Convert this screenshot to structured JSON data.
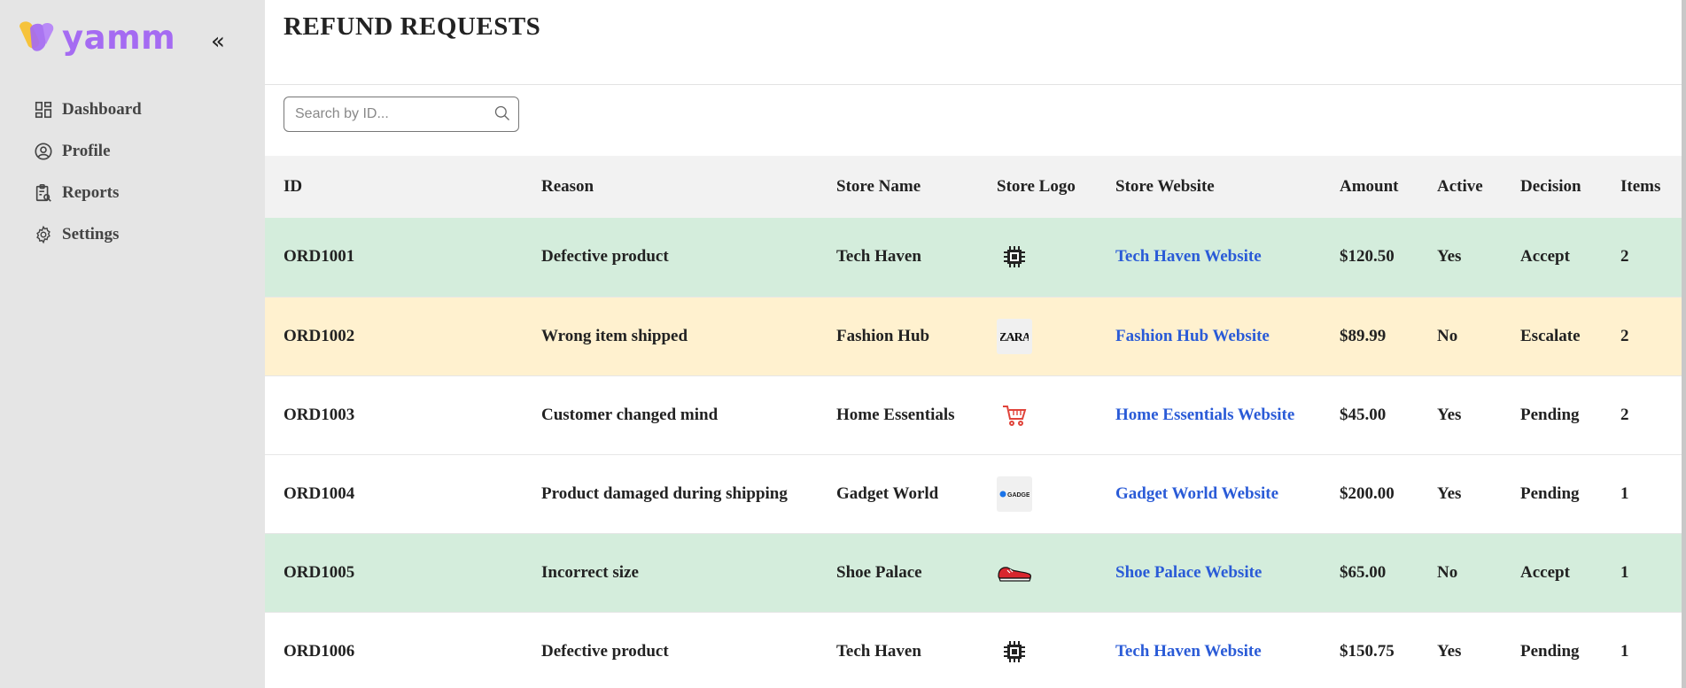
{
  "brand": {
    "name": "yamm",
    "primary": "#a56bf2",
    "secondary": "#f6c33b"
  },
  "sidebar": {
    "collapse_label": "«",
    "items": [
      {
        "label": "Dashboard",
        "icon": "dashboard-icon"
      },
      {
        "label": "Profile",
        "icon": "user-circle-icon"
      },
      {
        "label": "Reports",
        "icon": "clipboard-search-icon"
      },
      {
        "label": "Settings",
        "icon": "gear-icon"
      }
    ]
  },
  "page": {
    "title": "REFUND REQUESTS"
  },
  "search": {
    "placeholder": "Search by ID...",
    "value": ""
  },
  "table": {
    "headers": [
      "ID",
      "Reason",
      "Store Name",
      "Store Logo",
      "Store Website",
      "Amount",
      "Active",
      "Decision",
      "Items"
    ],
    "rows": [
      {
        "id": "ORD1001",
        "reason": "Defective product",
        "store": "Tech Haven",
        "logo": "chip-icon",
        "website": "Tech Haven Website",
        "amount": "$120.50",
        "active": "Yes",
        "decision": "Accept",
        "items": "2",
        "status": "accept"
      },
      {
        "id": "ORD1002",
        "reason": "Wrong item shipped",
        "store": "Fashion Hub",
        "logo": "zara-logo",
        "website": "Fashion Hub Website",
        "amount": "$89.99",
        "active": "No",
        "decision": "Escalate",
        "items": "2",
        "status": "escalate"
      },
      {
        "id": "ORD1003",
        "reason": "Customer changed mind",
        "store": "Home Essentials",
        "logo": "cart-icon",
        "website": "Home Essentials Website",
        "amount": "$45.00",
        "active": "Yes",
        "decision": "Pending",
        "items": "2",
        "status": "pending"
      },
      {
        "id": "ORD1004",
        "reason": "Product damaged during shipping",
        "store": "Gadget World",
        "logo": "gadget-logo",
        "website": "Gadget World Website",
        "amount": "$200.00",
        "active": "Yes",
        "decision": "Pending",
        "items": "1",
        "status": "pending"
      },
      {
        "id": "ORD1005",
        "reason": "Incorrect size",
        "store": "Shoe Palace",
        "logo": "sneaker-icon",
        "website": "Shoe Palace Website",
        "amount": "$65.00",
        "active": "No",
        "decision": "Accept",
        "items": "1",
        "status": "accept"
      },
      {
        "id": "ORD1006",
        "reason": "Defective product",
        "store": "Tech Haven",
        "logo": "chip-icon",
        "website": "Tech Haven Website",
        "amount": "$150.75",
        "active": "Yes",
        "decision": "Pending",
        "items": "1",
        "status": "pending"
      }
    ]
  },
  "colors": {
    "accept_row": "#d4eddc",
    "escalate_row": "#fff1cf",
    "pending_row": "#ffffff",
    "link": "#2a5bd7",
    "sidebar_bg": "#e5e5e5"
  }
}
